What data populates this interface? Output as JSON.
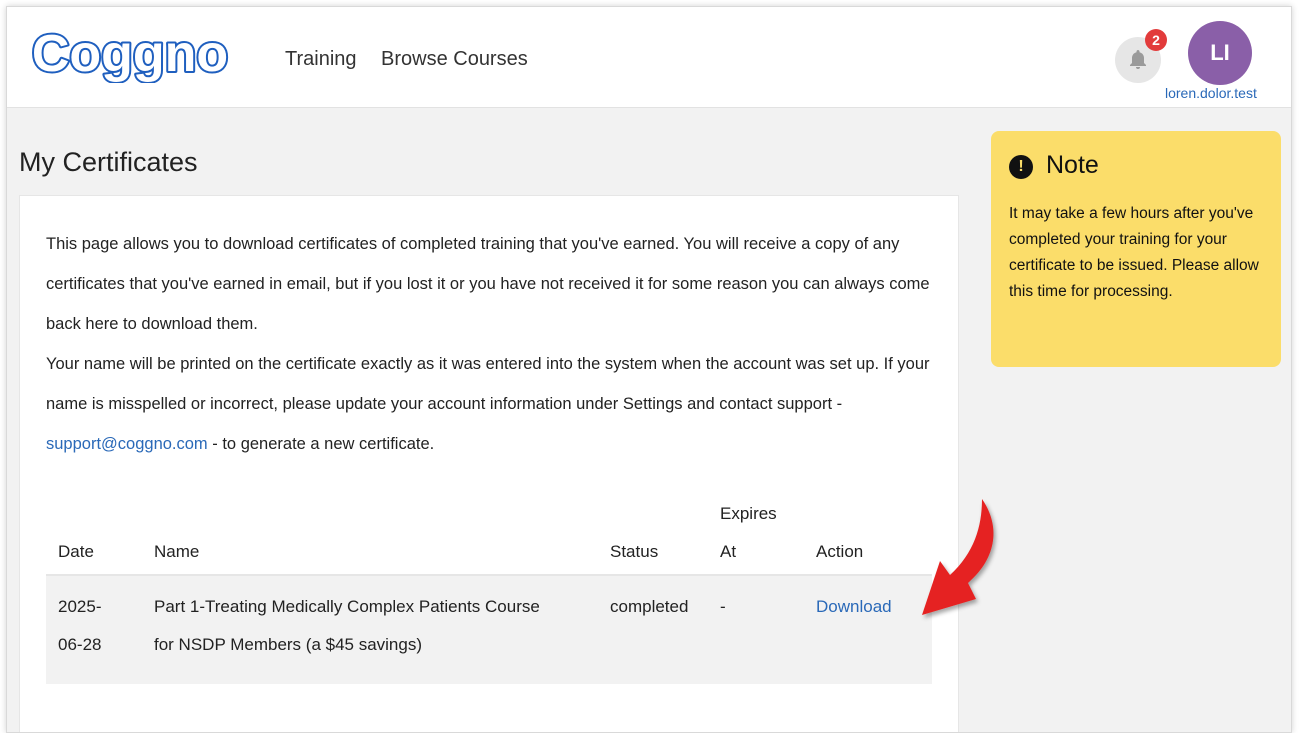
{
  "header": {
    "logo_text": "Coggno",
    "nav": {
      "training": "Training",
      "browse_courses": "Browse Courses"
    },
    "notifications": {
      "count": "2",
      "icon": "bell-icon"
    },
    "user": {
      "initials": "LI",
      "username": "loren.dolor.test"
    }
  },
  "page": {
    "title": "My Certificates"
  },
  "intro": {
    "p1": "This page allows you to download certificates of completed training that you've earned. You will receive a copy of any certificates that you've earned in email, but if you lost it or you have not received it for some reason you can always come back here to download them.",
    "p2_before": "Your name will be printed on the certificate exactly as it was entered into the system when the account was set up. If your name is misspelled or incorrect, please update your account information under Settings and contact support - ",
    "support_email": "support@coggno.com",
    "p2_after": " - to generate a new certificate."
  },
  "table": {
    "headers": {
      "date": "Date",
      "name": "Name",
      "status": "Status",
      "expires_line1": "Expires",
      "expires_line2": "At",
      "action": "Action"
    },
    "rows": [
      {
        "date_line1": "2025-",
        "date_line2": "06-28",
        "name_line1": "Part 1-Treating Medically Complex Patients Course",
        "name_line2": "for NSDP Members (a $45 savings)",
        "status": "completed",
        "expires": "-",
        "action": "Download"
      }
    ]
  },
  "note": {
    "title": "Note",
    "text": "It may take a few hours after you've completed your training for your certificate to be issued. Please allow this time for processing."
  },
  "colors": {
    "brand_blue": "#1f5fbf",
    "link_blue": "#2a69b8",
    "note_yellow": "#fbdd6a",
    "avatar_purple": "#8a5fa8",
    "badge_red": "#e23b3b",
    "arrow_red": "#e52420"
  }
}
